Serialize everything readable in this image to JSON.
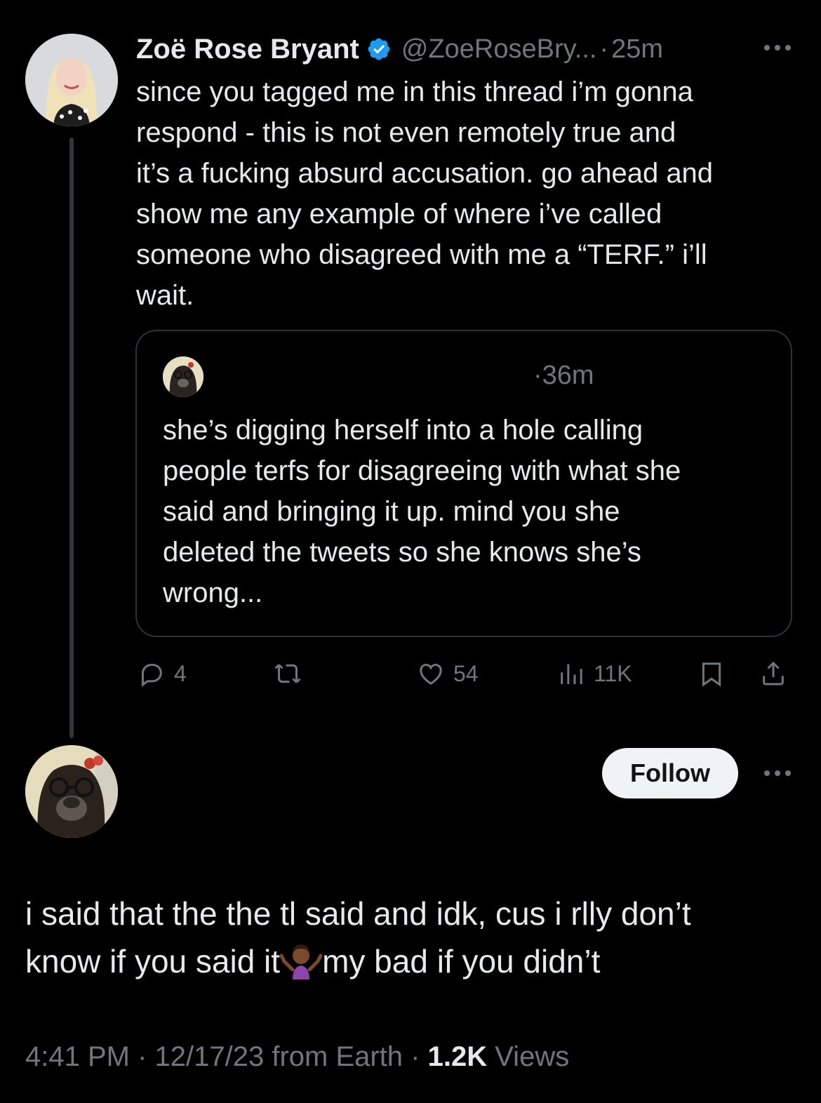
{
  "original_tweet": {
    "author_name": "Zoë Rose Bryant",
    "author_handle": "@ZoeRoseBry...",
    "separator": "·",
    "time": "25m",
    "text": "since you tagged me in this thread i’m gonna\nrespond - this is not even remotely true and\nit’s a fucking absurd accusation. go ahead and\nshow me any example of where i’ve called\nsomeone who disagreed with me a “TERF.” i’ll\nwait.",
    "quote": {
      "time": "·36m",
      "text": "she’s digging herself into a hole calling\npeople terfs for disagreeing with what she\nsaid and bringing it up. mind you she\ndeleted the tweets so she knows she’s\nwrong..."
    },
    "actions": {
      "replies": "4",
      "likes": "54",
      "views": "11K"
    }
  },
  "reply_tweet": {
    "follow_label": "Follow",
    "text_before_emoji": "i said that the the tl said and idk, cus i rlly don’t\nknow if you said it",
    "emoji": "person-shrugging-emoji",
    "text_after_emoji": "my bad if you didn’t",
    "meta": {
      "time": "4:41 PM",
      "sep1": " · ",
      "date": "12/17/23",
      "source": " from Earth",
      "sep2": " · ",
      "views_count": "1.2K",
      "views_label": " Views"
    }
  },
  "colors": {
    "background": "#000000",
    "text": "#e7e9ea",
    "muted": "#71767b",
    "verified": "#1d9bf0",
    "border": "#2f3336"
  }
}
